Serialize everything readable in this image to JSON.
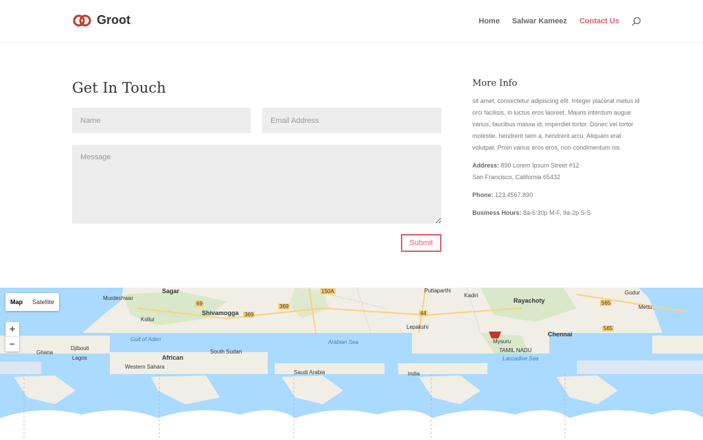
{
  "header": {
    "logo_text": "Groot",
    "nav": [
      "Home",
      "Salwar Kameez",
      "Contact Us"
    ],
    "active_nav": "Contact Us"
  },
  "contact": {
    "title": "Get In Touch",
    "name_placeholder": "Name",
    "email_placeholder": "Email Address",
    "message_placeholder": "Message",
    "submit_label": "Submit"
  },
  "info": {
    "title": "More Info",
    "body": "sit amet, consectetur adipiscing elit. Integer placerat metus id orci facilisis, in luctus eros laoreet. Mauris interdum augue varius, faucibus massa id, imperdiet tortor. Donec vel tortor molestie, hendrerit sem a, hendrerit arcu. Aliquam erat volutpat. Proin varius eros eros, non condimentum nis.",
    "address_label": "Address:",
    "address_line1": "890 Lorem Ipsum Street #12",
    "address_line2": "San Francisco, California 65432",
    "phone_label": "Phone:",
    "phone_value": "123.4567.890",
    "hours_label": "Business Hours:",
    "hours_value": "8a-6:30p M-F, 9a-2p S-S"
  },
  "map": {
    "type_map": "Map",
    "type_satellite": "Satellite",
    "zoom_in": "+",
    "zoom_out": "−",
    "labels": {
      "sagar": "Sagar",
      "murdeshwar": "Murdeshwar",
      "shivamogga": "Shivamogga",
      "kollur": "Kollur",
      "puttaparthi": "Puttaparthi",
      "kadiri": "Kadiri",
      "rayachoty": "Rayachoty",
      "gudur": "Gudur",
      "mettu": "Mettu",
      "lepakshi": "Lepakshi",
      "gulf_of_aden": "Gulf of Aden",
      "arabian_sea": "Arabian Sea",
      "mysuru": "Mysuru",
      "chennai": "Chennai",
      "tamil_nadu": "TAMIL NADU",
      "laccadive_sea": "Laccadive Sea",
      "djibouti": "Djibouti",
      "lagos": "Lagos",
      "ghana": "Ghana",
      "african": "African",
      "south_sudan": "South Sudan",
      "western_sahara": "Western Sahara",
      "saudi_arabia": "Saudi Arabia",
      "india": "India",
      "road_369a": "369",
      "road_369b": "369",
      "road_69": "69",
      "road_150a": "150A",
      "road_44": "44",
      "road_565a": "565",
      "road_565b": "565"
    }
  },
  "colors": {
    "accent": "#e05a6a",
    "water": "#aadaff",
    "land": "#f1eee6"
  }
}
